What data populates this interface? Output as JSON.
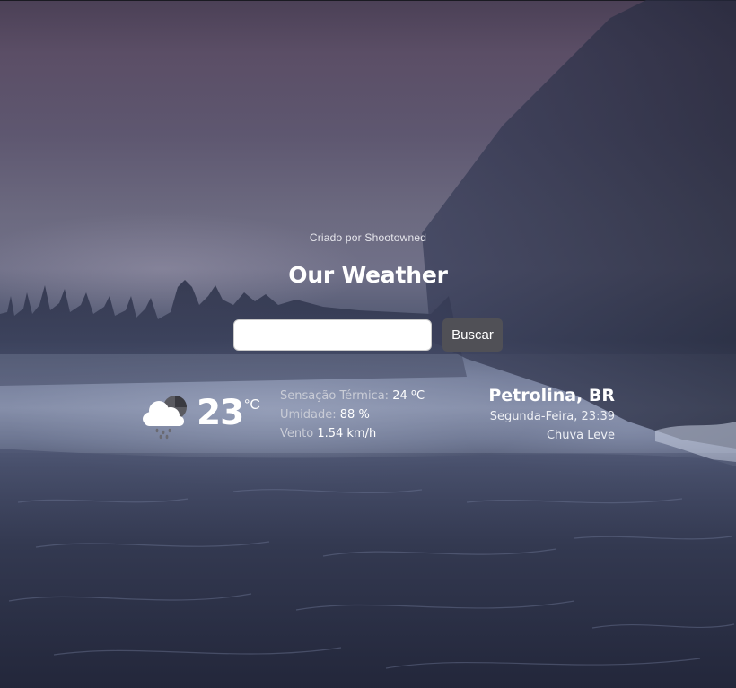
{
  "app": {
    "credit": "Criado por Shootowned",
    "title": "Our Weather"
  },
  "search": {
    "value": "",
    "placeholder": "",
    "button_label": "Buscar"
  },
  "weather": {
    "icon": "cloud-rain-icon",
    "temperature": "23",
    "unit": "°C",
    "feels_like_label": "Sensação Térmica:",
    "feels_like_value": "24 ºC",
    "humidity_label": "Umidade:",
    "humidity_value": "88 %",
    "wind_label": "Vento",
    "wind_value": "1.54 km/h"
  },
  "location": {
    "city": "Petrolina, BR",
    "datetime": "Segunda-Feira, 23:39",
    "condition": "Chuva Leve"
  },
  "colors": {
    "button_bg": "#505056",
    "text": "#ffffff",
    "muted_text": "#c9ccd6"
  }
}
